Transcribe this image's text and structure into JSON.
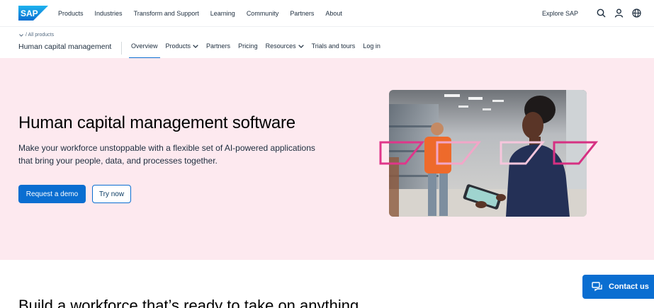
{
  "topnav": {
    "logo_text": "SAP",
    "links": [
      "Products",
      "Industries",
      "Transform and Support",
      "Learning",
      "Community",
      "Partners",
      "About"
    ],
    "explore_label": "Explore SAP",
    "icons": [
      "search-icon",
      "user-icon",
      "globe-icon"
    ]
  },
  "subnav": {
    "breadcrumb": "/ All products",
    "title": "Human capital management",
    "links": [
      {
        "label": "Overview",
        "active": true,
        "dropdown": false
      },
      {
        "label": "Products",
        "active": false,
        "dropdown": true
      },
      {
        "label": "Partners",
        "active": false,
        "dropdown": false
      },
      {
        "label": "Pricing",
        "active": false,
        "dropdown": false
      },
      {
        "label": "Resources",
        "active": false,
        "dropdown": true
      },
      {
        "label": "Trials and tours",
        "active": false,
        "dropdown": false
      },
      {
        "label": "Log in",
        "active": false,
        "dropdown": false
      }
    ]
  },
  "hero": {
    "title": "Human capital management software",
    "description": "Make your workforce unstoppable with a flexible set of AI-powered applications that bring your people, data, and processes together.",
    "primary_cta": "Request a demo",
    "secondary_cta": "Try now"
  },
  "section": {
    "title": "Build a workforce that’s ready to take on anything"
  },
  "contact": {
    "label": "Contact us"
  },
  "colors": {
    "brand_blue": "#0a6ed1",
    "hero_background": "#fde9ef",
    "accent_pink": "#e0368a"
  }
}
